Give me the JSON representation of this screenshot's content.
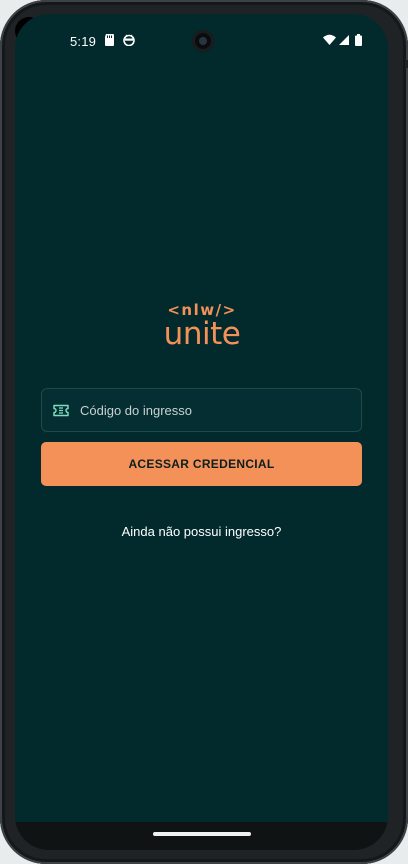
{
  "status_bar": {
    "time": "5:19",
    "icons": [
      "sd-card-icon",
      "cat-face-icon",
      "wifi-icon",
      "signal-icon",
      "battery-icon"
    ]
  },
  "logo": {
    "top_text": "<nlw/>",
    "main_text": "unite",
    "color": "#f39159"
  },
  "login": {
    "ticket_placeholder": "Código do ingresso",
    "ticket_value": "",
    "ticket_icon": "ticket-icon",
    "access_button_label": "ACESSAR CREDENCIAL",
    "no_ticket_link": "Ainda não possui ingresso?"
  },
  "colors": {
    "background": "#022a2c",
    "accent": "#f39159",
    "field_border": "#1e4a4c",
    "text": "#ffffff"
  }
}
